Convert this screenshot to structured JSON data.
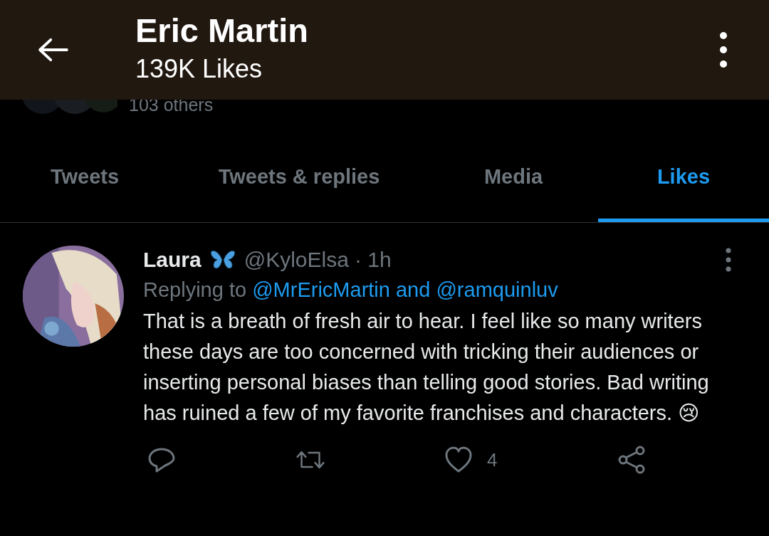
{
  "header": {
    "title": "Eric Martin",
    "subtitle": "139K Likes"
  },
  "followers_note": "103 others",
  "tabs": [
    {
      "label": "Tweets",
      "selected": false
    },
    {
      "label": "Tweets & replies",
      "selected": false
    },
    {
      "label": "Media",
      "selected": false
    },
    {
      "label": "Likes",
      "selected": true
    }
  ],
  "tweet": {
    "name": "Laura",
    "handle": "@KyloElsa",
    "time": "· 1h",
    "replying_label": "Replying to",
    "replying_to": "@MrEricMartin and @ramquinluv",
    "text": "That is a breath of fresh air to hear. I feel like so many writers these days are too concerned with tricking their audiences or inserting personal biases than telling good stories. Bad writing has ruined a few of my favorite franchises and characters. 😢",
    "like_count": "4"
  }
}
